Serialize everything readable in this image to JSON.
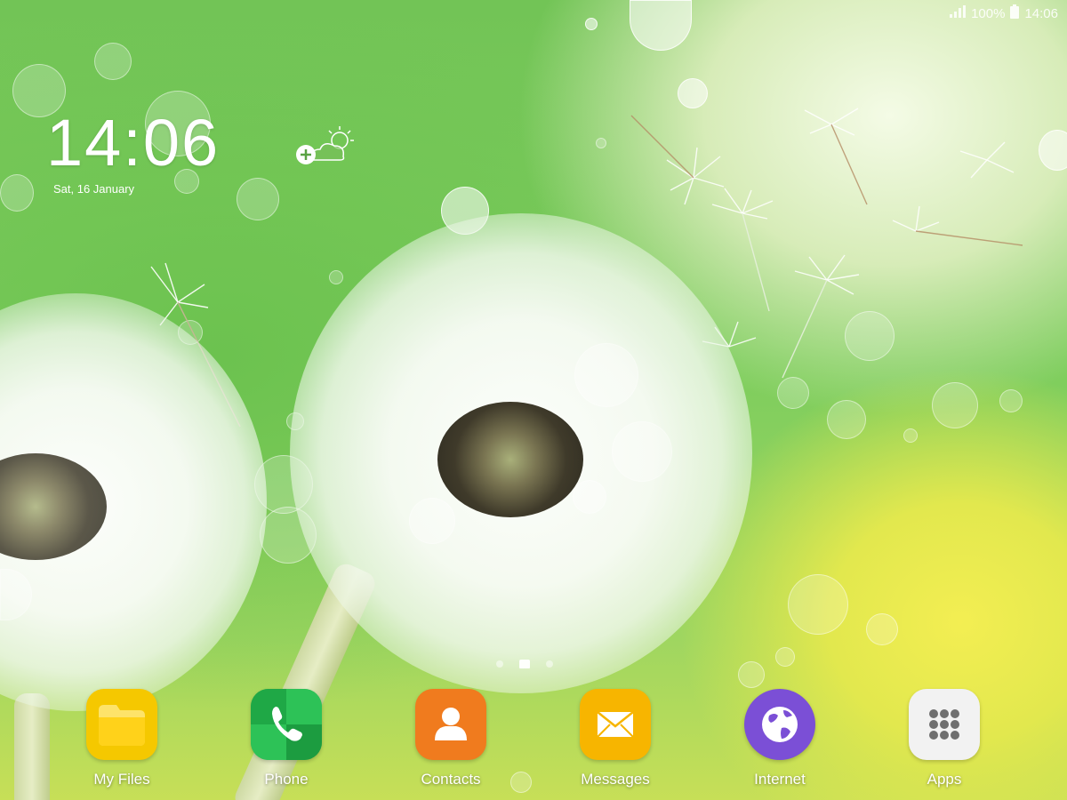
{
  "status_bar": {
    "battery": "100%",
    "time": "14:06"
  },
  "clock_widget": {
    "time": "14:06",
    "date": "Sat, 16 January"
  },
  "weather_widget": {
    "icon": "add-weather-icon"
  },
  "page_indicator": {
    "pages": 3,
    "current_page": 2,
    "home_page": 2
  },
  "dock": {
    "apps": [
      {
        "label": "My Files",
        "icon": "folder-icon",
        "color": "#f5c800"
      },
      {
        "label": "Phone",
        "icon": "phone-icon",
        "color": "#22b14c"
      },
      {
        "label": "Contacts",
        "icon": "contact-person-icon",
        "color": "#f07b1e"
      },
      {
        "label": "Messages",
        "icon": "envelope-icon",
        "color": "#f7b500"
      },
      {
        "label": "Internet",
        "icon": "globe-icon",
        "color": "#7b4fd6"
      },
      {
        "label": "Apps",
        "icon": "apps-grid-icon",
        "color": "#f2f2f2"
      }
    ]
  },
  "wallpaper": {
    "colors": {
      "green": "#72c456",
      "yellow": "#f3ee52",
      "white": "#ffffff"
    }
  }
}
